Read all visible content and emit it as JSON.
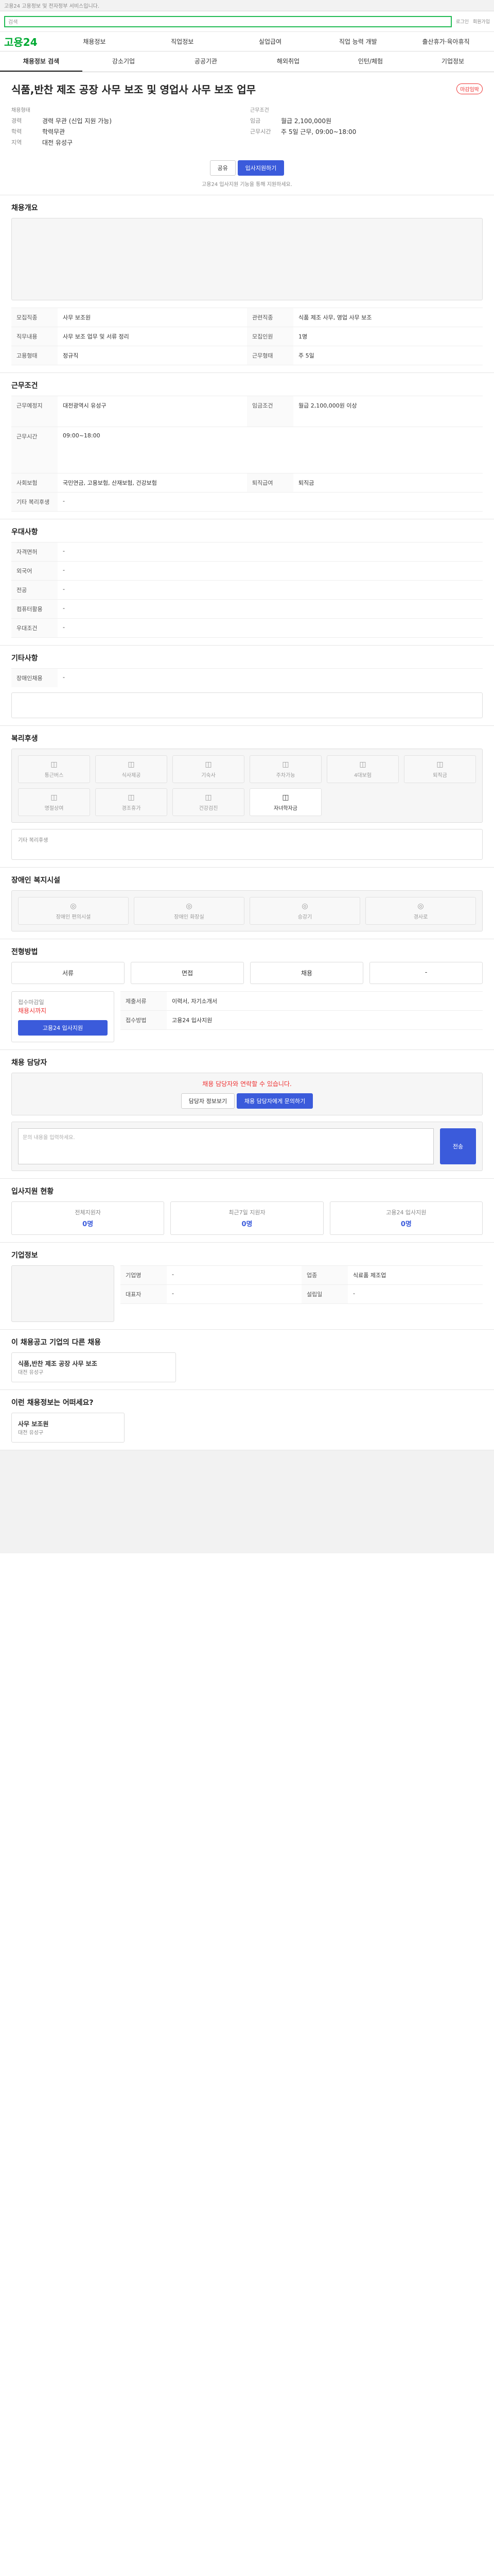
{
  "topnote": "고용24 고용정보 및 전자정부 서비스입니다.",
  "search_placeholder": "검색",
  "util_links": [
    "로그인",
    "회원가입"
  ],
  "logo": "고용24",
  "nav": [
    "채용정보",
    "직업정보",
    "실업급여",
    "직업 능력 개발",
    "출산휴가·육아휴직"
  ],
  "tabs_top": [
    "채용정보 검색",
    "강소기업",
    "공공기관",
    "해외취업",
    "인턴/체험",
    "기업정보"
  ],
  "job": {
    "company_label": "",
    "title": "식품,반찬 제조 공장 사무 보조 및 영업사 사무 보조 업무",
    "badge": "마감임박",
    "left_head": "채용형태",
    "left_rows": [
      {
        "k": "경력",
        "v": "경력 무관 (신입 지원 가능)"
      },
      {
        "k": "학력",
        "v": "학력무관"
      },
      {
        "k": "지역",
        "v": "대전 유성구"
      }
    ],
    "right_head": "근무조건",
    "right_rows": [
      {
        "k": "임금",
        "v": "월급 2,100,000원"
      },
      {
        "k": "근무시간",
        "v": "주 5일 근무, 09:00~18:00"
      },
      {
        "k": "",
        "v": ""
      }
    ],
    "buttons": {
      "share": "공유",
      "apply": "입사지원하기"
    },
    "notice": "고용24 입사지원 기능을 통해 지원하세요."
  },
  "section_titles": {
    "summary": "채용개요",
    "conditions": "근무조건",
    "welfare": "복리후생",
    "disability": "장애인 복지시설",
    "qual": "우대사항",
    "etc": "기타사항",
    "apply": "전형방법",
    "consult": "채용 담당자",
    "review": "입사지원 현황",
    "company": "기업정보",
    "more": "이 채용공고 기업의 다른 채용",
    "recommend": "이런 채용정보는 어떠세요?"
  },
  "summary_rows": [
    {
      "k": "모집직종",
      "v": "사무 보조원"
    },
    {
      "k": "관련직종",
      "v": "식품 제조 사무, 영업 사무 보조"
    },
    {
      "k": "직무내용",
      "v": "사무 보조 업무 및 서류 정리"
    },
    {
      "k": "모집인원",
      "v": "1명"
    },
    {
      "k": "고용형태",
      "v": "정규직"
    },
    {
      "k": "근무형태",
      "v": "주 5일"
    }
  ],
  "condition_rows": [
    {
      "k": "근무예정지",
      "v": "대전광역시 유성구"
    },
    {
      "k": "임금조건",
      "v": "월급 2,100,000원 이상"
    },
    {
      "k": "근무시간",
      "v": "09:00~18:00"
    },
    {
      "k": "사회보험",
      "v": "국민연금, 고용보험, 산재보험, 건강보험"
    },
    {
      "k": "퇴직급여",
      "v": "퇴직금"
    },
    {
      "k": "기타 복리후생",
      "v": "-"
    }
  ],
  "welfare_items": [
    "통근버스",
    "식사제공",
    "기숙사",
    "주차가능",
    "4대보험",
    "퇴직금",
    "명절상여",
    "경조휴가",
    "건강검진",
    "자녀학자금"
  ],
  "welfare_note": "기타 복리후생",
  "disability_items": [
    "장애인 편의시설",
    "장애인 화장실",
    "승강기",
    "경사로"
  ],
  "qual_rows": [
    {
      "k": "자격면허",
      "v": "-"
    },
    {
      "k": "외국어",
      "v": "-"
    },
    {
      "k": "전공",
      "v": "-"
    },
    {
      "k": "컴퓨터활용",
      "v": "-"
    },
    {
      "k": "우대조건",
      "v": "-"
    },
    {
      "k": "장애인채용",
      "v": "-"
    }
  ],
  "apply_steps": [
    "서류",
    "면접",
    "채용",
    "-"
  ],
  "apply_rows": [
    {
      "k": "접수마감일",
      "v": "채용시까지"
    },
    {
      "k": "제출서류",
      "v": "이력서, 자기소개서"
    },
    {
      "k": "접수방법",
      "v": "고용24 입사지원"
    }
  ],
  "apply_button": "고용24 입사지원",
  "consult": {
    "notice": "채용 담당자와 연락할 수 있습니다.",
    "btn1": "담당자 정보보기",
    "btn2": "채용 담당자에게 문의하기",
    "textarea": "문의 내용을 입력하세요.",
    "submit": "전송"
  },
  "stats": [
    {
      "k": "전체지원자",
      "v": "0명"
    },
    {
      "k": "최근7일 지원자",
      "v": "0명"
    },
    {
      "k": "고용24 입사지원",
      "v": "0명"
    }
  ],
  "company_rows": [
    {
      "k": "기업명",
      "v": "-"
    },
    {
      "k": "업종",
      "v": "식료품 제조업"
    },
    {
      "k": "대표자",
      "v": "-"
    },
    {
      "k": "설립일",
      "v": "-"
    }
  ],
  "more_item": {
    "title": "식품,반찬 제조 공장 사무 보조",
    "meta": "대전 유성구"
  },
  "recommend": {
    "item": "사무 보조원",
    "meta": "대전 유성구"
  }
}
